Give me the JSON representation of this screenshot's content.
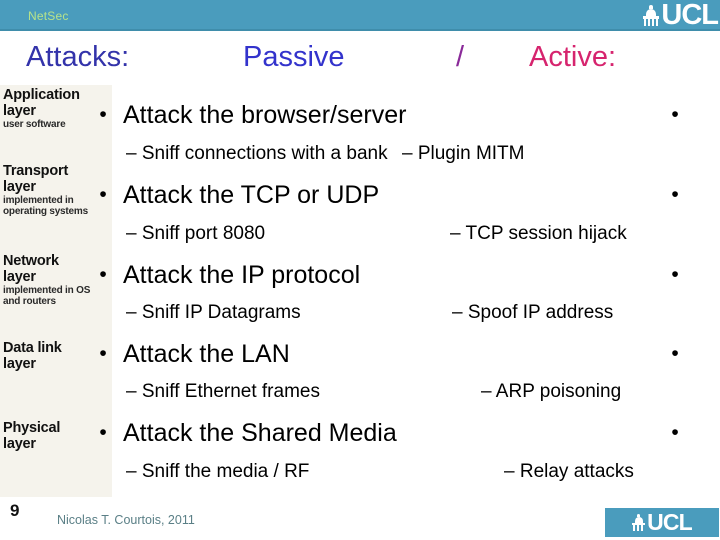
{
  "header": {
    "title": "NetSec",
    "logo_text": "UCL",
    "logo_icon": "ucl-dome-icon",
    "band_color": "#4a9cbd",
    "title_color": "#b7e38a"
  },
  "slide": {
    "title_parts": {
      "attacks": "Attacks:",
      "passive": "Passive",
      "separator": "/",
      "active": "Active:"
    },
    "title_colors": {
      "attacks": "#3333aa",
      "passive": "#3333cc",
      "separator": "#8a2a99",
      "active": "#d6246e"
    }
  },
  "sidebar": {
    "layers": [
      {
        "name": "Application\nlayer",
        "name_line1": "Application",
        "name_line2": "layer",
        "sub": "user software"
      },
      {
        "name_line1": "Transport",
        "name_line2": "layer",
        "sub": "implemented in\noperating systems",
        "sub_line1": "implemented in",
        "sub_line2": "operating systems"
      },
      {
        "name_line1": "Network",
        "name_line2": "layer",
        "sub_line1": "implemented in OS",
        "sub_line2": "and routers"
      },
      {
        "name_line1": "Data link",
        "name_line2": "layer",
        "sub_line1": "",
        "sub_line2": ""
      },
      {
        "name_line1": "Physical",
        "name_line2": "layer",
        "sub_line1": "",
        "sub_line2": ""
      }
    ]
  },
  "content": {
    "bullet_glyph": "•",
    "dash_glyph": "–",
    "rows": [
      {
        "main": "Attack the browser/server",
        "sub_passive": "– Sniff connections with a bank",
        "sub_active": "– Plugin MITM"
      },
      {
        "main": "Attack the TCP or UDP",
        "sub_passive": "– Sniff port 8080",
        "sub_active": "–  TCP session hijack"
      },
      {
        "main": "Attack the IP protocol",
        "sub_passive": "– Sniff IP Datagrams",
        "sub_active": "– Spoof IP address"
      },
      {
        "main": "Attack the LAN",
        "sub_passive": "– Sniff Ethernet frames",
        "sub_active": "– ARP poisoning"
      },
      {
        "main": "Attack the Shared Media",
        "sub_passive": "– Sniff the media / RF",
        "sub_active": "– Relay attacks"
      }
    ]
  },
  "footer": {
    "slide_number": "9",
    "credit": "Nicolas T. Courtois, 2011",
    "logo_text": "UCL",
    "logo_bg": "#4a9cbd"
  }
}
